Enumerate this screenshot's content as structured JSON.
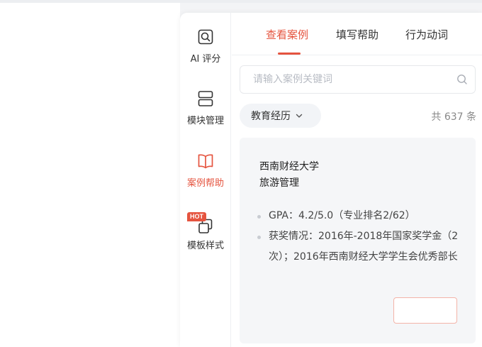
{
  "sidebar": {
    "items": [
      {
        "label": "AI 评分",
        "icon": "ai-score-icon"
      },
      {
        "label": "模块管理",
        "icon": "modules-icon"
      },
      {
        "label": "案例帮助",
        "icon": "book-icon",
        "active": true
      },
      {
        "label": "模板样式",
        "icon": "template-icon",
        "badge": "HOT"
      }
    ]
  },
  "tabs": [
    {
      "label": "查看案例",
      "active": true
    },
    {
      "label": "填写帮助"
    },
    {
      "label": "行为动词"
    }
  ],
  "search": {
    "placeholder": "请输入案例关键词",
    "value": ""
  },
  "filter": {
    "label": "教育经历"
  },
  "count": {
    "text": "共 637 条"
  },
  "card": {
    "school": "西南财经大学",
    "major": "旅游管理",
    "bullets": [
      "GPA：4.2/5.0（专业排名2/62）",
      "获奖情况：2016年-2018年国家奖学金（2次）；2016年西南财经大学学生会优秀部长"
    ]
  },
  "colors": {
    "accent": "#e5543f",
    "card_bg": "#f5f6f8",
    "filter_bg": "#f2f4f7"
  }
}
